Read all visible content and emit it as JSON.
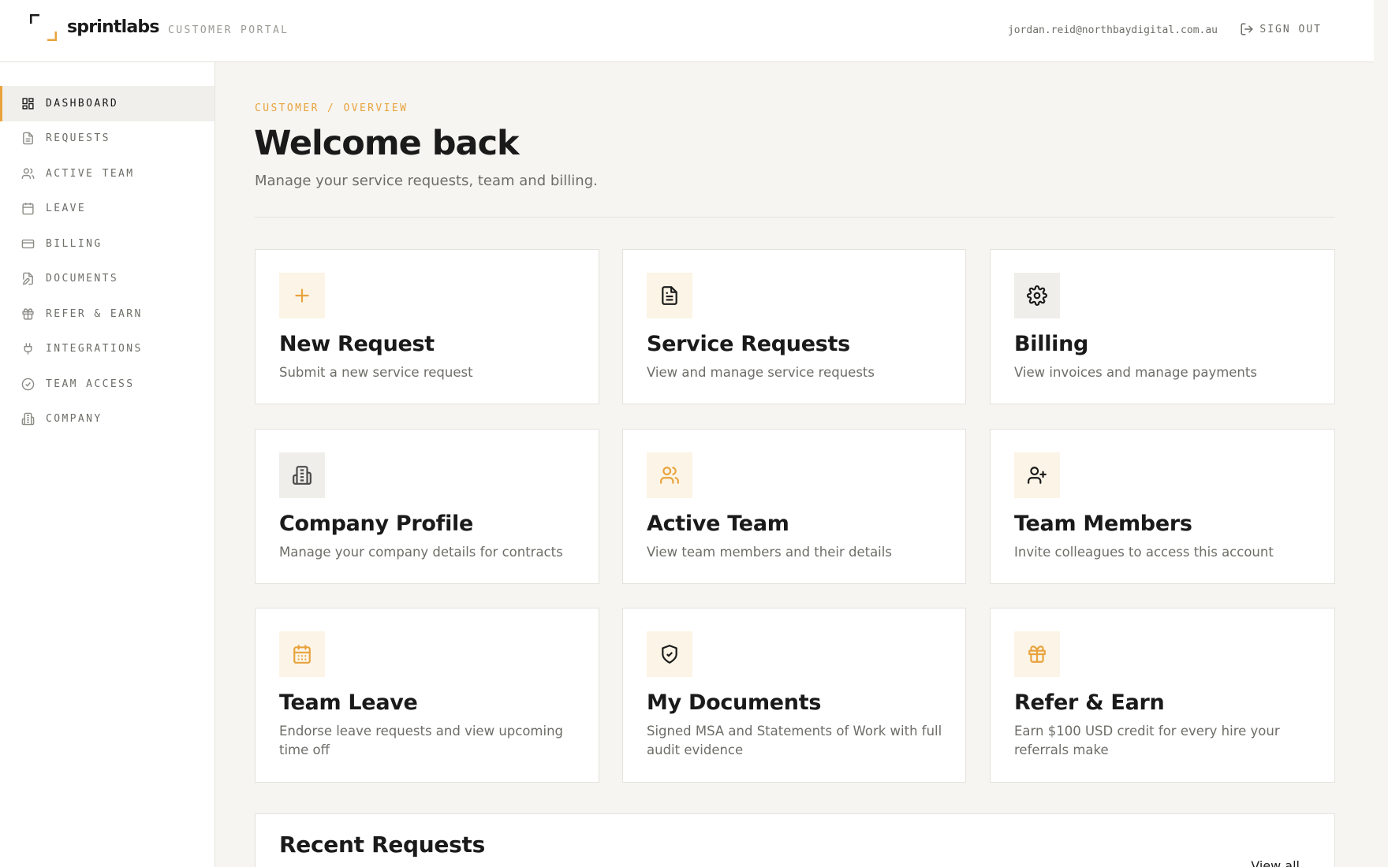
{
  "header": {
    "brand": "sprintlabs",
    "portal_label": "CUSTOMER PORTAL",
    "user_email": "jordan.reid@northbaydigital.com.au",
    "sign_out_label": "SIGN OUT",
    "accent_color": "#e8a33d"
  },
  "sidebar": {
    "items": [
      {
        "label": "DASHBOARD",
        "icon": "dashboard-icon",
        "active": true
      },
      {
        "label": "REQUESTS",
        "icon": "file-icon"
      },
      {
        "label": "ACTIVE TEAM",
        "icon": "users-icon"
      },
      {
        "label": "LEAVE",
        "icon": "calendar-icon"
      },
      {
        "label": "BILLING",
        "icon": "credit-card-icon"
      },
      {
        "label": "DOCUMENTS",
        "icon": "file-edit-icon"
      },
      {
        "label": "REFER & EARN",
        "icon": "gift-icon"
      },
      {
        "label": "INTEGRATIONS",
        "icon": "plug-icon"
      },
      {
        "label": "TEAM ACCESS",
        "icon": "check-circle-icon"
      },
      {
        "label": "COMPANY",
        "icon": "building-icon"
      }
    ]
  },
  "main": {
    "breadcrumb": "CUSTOMER / OVERVIEW",
    "title": "Welcome back",
    "subtitle": "Manage your service requests, team and billing.",
    "cards": [
      {
        "title": "New Request",
        "description": "Submit a new service request",
        "icon": "plus-icon"
      },
      {
        "title": "Service Requests",
        "description": "View and manage service requests",
        "icon": "document-icon"
      },
      {
        "title": "Billing",
        "description": "View invoices and manage payments",
        "icon": "gear-icon"
      },
      {
        "title": "Company Profile",
        "description": "Manage your company details for contracts",
        "icon": "building-icon"
      },
      {
        "title": "Active Team",
        "description": "View team members and their details",
        "icon": "users-icon"
      },
      {
        "title": "Team Members",
        "description": "Invite colleagues to access this account",
        "icon": "user-plus-icon"
      },
      {
        "title": "Team Leave",
        "description": "Endorse leave requests and view upcoming time off",
        "icon": "calendar-icon"
      },
      {
        "title": "My Documents",
        "description": "Signed MSA and Statements of Work with full audit evidence",
        "icon": "shield-check-icon"
      },
      {
        "title": "Refer & Earn",
        "description": "Earn $100 USD credit for every hire your referrals make",
        "icon": "gift-icon"
      }
    ],
    "recent": {
      "title": "Recent Requests",
      "view_all_label": "View all"
    }
  }
}
